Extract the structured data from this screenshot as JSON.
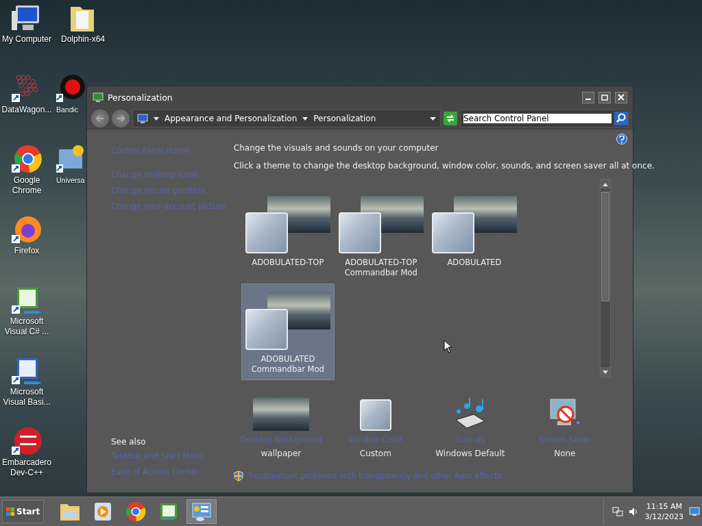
{
  "desktop": {
    "columns": [
      [
        {
          "label": "My Computer",
          "kind": "computer"
        },
        {
          "label": "DataWagon...",
          "kind": "dots"
        },
        {
          "label": "Google Chrome",
          "kind": "chrome"
        },
        {
          "label": "Firefox",
          "kind": "firefox"
        },
        {
          "label": "Microsoft Visual C# ...",
          "kind": "csharp"
        },
        {
          "label": "Microsoft Visual Basi...",
          "kind": "vb"
        },
        {
          "label": "Embarcadero Dev-C++",
          "kind": "devcpp"
        }
      ],
      [
        {
          "label": "Dolphin-x64",
          "kind": "folder"
        },
        {
          "label": "Bandic",
          "kind": "record"
        },
        {
          "label": "Universa",
          "kind": "app"
        }
      ]
    ]
  },
  "window": {
    "title": "Personalization",
    "breadcrumb": [
      "Appearance and Personalization",
      "Personalization"
    ],
    "search": {
      "placeholder": "Search Control Panel"
    },
    "sidebar": {
      "home": "Control Panel Home",
      "tasks": [
        "Change desktop icons",
        "Change mouse pointers",
        "Change your account picture"
      ],
      "see_also_title": "See also",
      "see_also": [
        "Taskbar and Start Menu",
        "Ease of Access Center"
      ]
    },
    "heading": "Change the visuals and sounds on your computer",
    "subheading": "Click a theme to change the desktop background, window color, sounds, and screen saver all at once.",
    "themes": [
      {
        "name": "ADOBULATED-TOP",
        "selected": false
      },
      {
        "name": "ADOBULATED-TOP Commandbar Mod",
        "selected": false
      },
      {
        "name": "ADOBULATED",
        "selected": false
      },
      {
        "name": "ADOBULATED Commandbar Mod",
        "selected": true
      }
    ],
    "settings": [
      {
        "kind": "background",
        "link": "Desktop Background",
        "value": "wallpaper"
      },
      {
        "kind": "color",
        "link": "Window Color",
        "value": "Custom"
      },
      {
        "kind": "sounds",
        "link": "Sounds",
        "value": "Windows Default"
      },
      {
        "kind": "screensaver",
        "link": "Screen Saver",
        "value": "None"
      }
    ],
    "troubleshoot": "Troubleshoot problems with transparency and other Aero effects"
  },
  "taskbar": {
    "start": "Start",
    "apps": [
      {
        "kind": "explorer",
        "selected": false
      },
      {
        "kind": "media",
        "selected": false
      },
      {
        "kind": "chrome",
        "selected": false
      },
      {
        "kind": "csharp",
        "selected": false
      },
      {
        "kind": "control",
        "selected": true
      }
    ],
    "time": "11:15 AM",
    "date": "3/12/2023"
  }
}
